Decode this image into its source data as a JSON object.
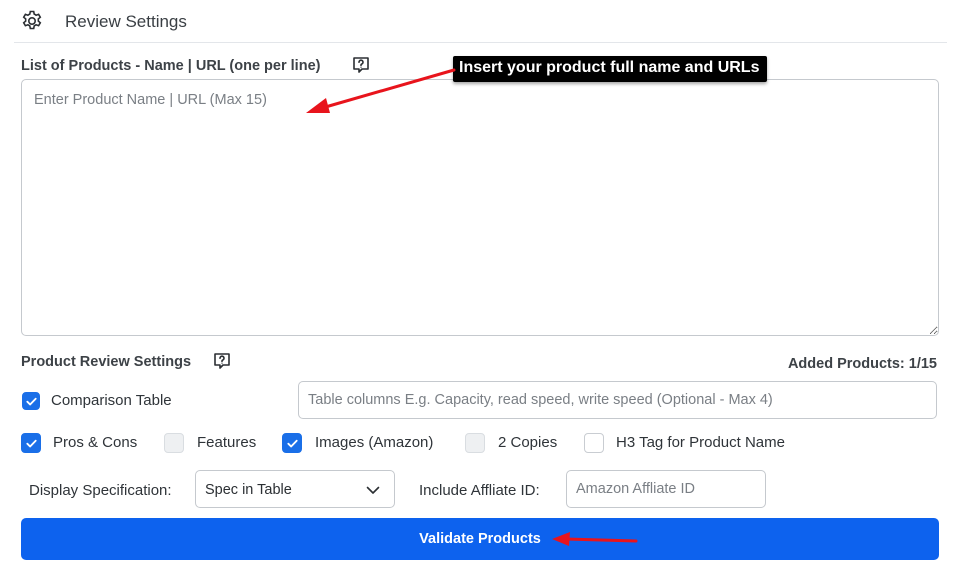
{
  "header": {
    "title": "Review Settings",
    "icon": "gear-icon"
  },
  "products": {
    "label": "List of Products - Name | URL (one per line)",
    "placeholder": "Enter Product Name | URL (Max 15)",
    "value": ""
  },
  "callout": {
    "text": "Insert your product full name and URLs"
  },
  "review_settings": {
    "label": "Product Review Settings",
    "added_products": "Added Products: 1/15"
  },
  "comparison_table": {
    "label": "Comparison Table",
    "checked": true,
    "columns_placeholder": "Table columns E.g. Capacity, read speed, write speed (Optional - Max 4)"
  },
  "options": [
    {
      "label": "Pros & Cons",
      "checked": true,
      "disabled": false
    },
    {
      "label": "Features",
      "checked": false,
      "disabled": true
    },
    {
      "label": "Images (Amazon)",
      "checked": true,
      "disabled": false
    },
    {
      "label": "2 Copies",
      "checked": false,
      "disabled": true
    },
    {
      "label": "H3 Tag for Product Name",
      "checked": false,
      "disabled": false
    }
  ],
  "display_spec": {
    "label": "Display Specification:",
    "selected": "Spec in Table"
  },
  "affiliate": {
    "label": "Include Affliate ID:",
    "placeholder": "Amazon Affliate ID"
  },
  "validate_button": {
    "label": "Validate Products"
  },
  "colors": {
    "primary": "#0d62ee",
    "checkbox": "#1a6fe8",
    "annotation": "#e8141c"
  }
}
